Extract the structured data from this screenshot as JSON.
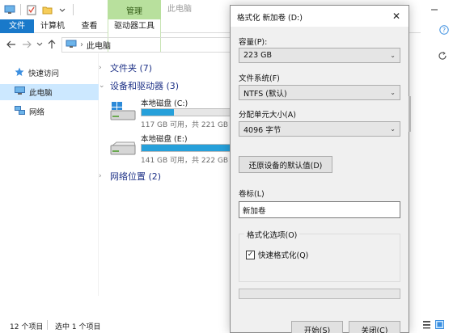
{
  "explorer": {
    "title": "此电脑",
    "manage_group": "管理",
    "tabs": {
      "file": "文件",
      "computer": "计算机",
      "view": "查看",
      "drive_tools": "驱动器工具"
    },
    "address": "此电脑",
    "sidebar": [
      {
        "label": "快速访问",
        "icon": "star-icon"
      },
      {
        "label": "此电脑",
        "icon": "computer-icon",
        "selected": true
      },
      {
        "label": "网络",
        "icon": "network-icon"
      }
    ],
    "sections": {
      "folders": "文件夹 (7)",
      "devices": "设备和驱动器 (3)",
      "network": "网络位置 (2)"
    },
    "drives": [
      {
        "name": "本地磁盘 (C:)",
        "free_text": "117 GB 可用，共 221 GB",
        "used_fraction": 0.47,
        "icon": "windows-drive-icon"
      },
      {
        "name": "本地磁盘 (E:)",
        "free_text": "141 GB 可用，共 222 GB",
        "used_fraction": 0.36,
        "icon": "drive-icon"
      }
    ],
    "status": {
      "count": "12 个项目",
      "selected": "选中 1 个项目"
    }
  },
  "dialog": {
    "title": "格式化 新加卷 (D:)",
    "capacity_label": "容量(P):",
    "capacity_value": "223 GB",
    "fs_label": "文件系统(F)",
    "fs_value": "NTFS (默认)",
    "alloc_label": "分配单元大小(A)",
    "alloc_value": "4096 字节",
    "restore_button": "还原设备的默认值(D)",
    "volume_label": "卷标(L)",
    "volume_value": "新加卷",
    "options_group": "格式化选项(O)",
    "quick_format": "快速格式化(Q)",
    "quick_format_checked": true,
    "start_button": "开始(S)",
    "close_button": "关闭(C)"
  },
  "colors": {
    "accent": "#1979ca",
    "drive_fill": "#26a0da",
    "section_text": "#1e3287",
    "manage_green": "#b8e09d"
  }
}
